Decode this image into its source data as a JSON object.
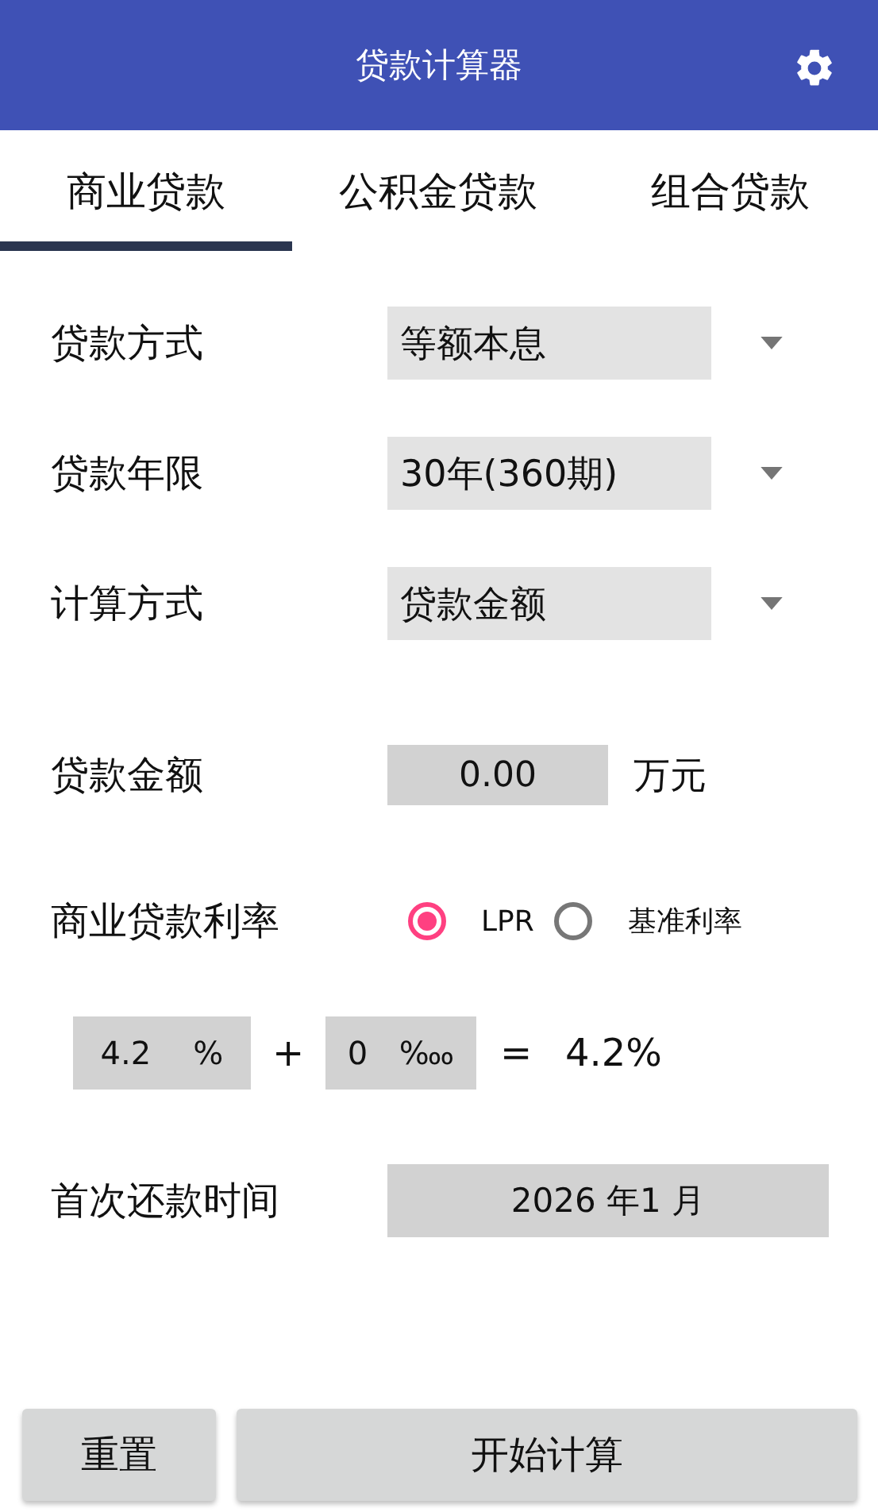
{
  "app_bar": {
    "title": "贷款计算器"
  },
  "tabs": [
    {
      "label": "商业贷款",
      "selected": true
    },
    {
      "label": "公积金贷款",
      "selected": false
    },
    {
      "label": "组合贷款",
      "selected": false
    }
  ],
  "selects": [
    {
      "label": "贷款方式",
      "value": "等额本息"
    },
    {
      "label": "贷款年限",
      "value": "30年(360期)"
    },
    {
      "label": "计算方式",
      "value": "贷款金额"
    }
  ],
  "amount": {
    "label": "贷款金额",
    "value": "0.00",
    "unit": "万元"
  },
  "rate": {
    "label": "商业贷款利率",
    "options": [
      {
        "label": "LPR",
        "selected": true
      },
      {
        "label": "基准利率",
        "selected": false
      }
    ],
    "base": {
      "value": "4.2",
      "unit": "%"
    },
    "plus": "+",
    "adjust": {
      "value": "0",
      "unit": "‱"
    },
    "equals": "=",
    "result": "4.2%"
  },
  "first_payment": {
    "label": "首次还款时间",
    "value": "2026 年1 月"
  },
  "buttons": [
    {
      "label": "重置",
      "kind": "reset"
    },
    {
      "label": "开始计算",
      "kind": "calculate"
    }
  ]
}
